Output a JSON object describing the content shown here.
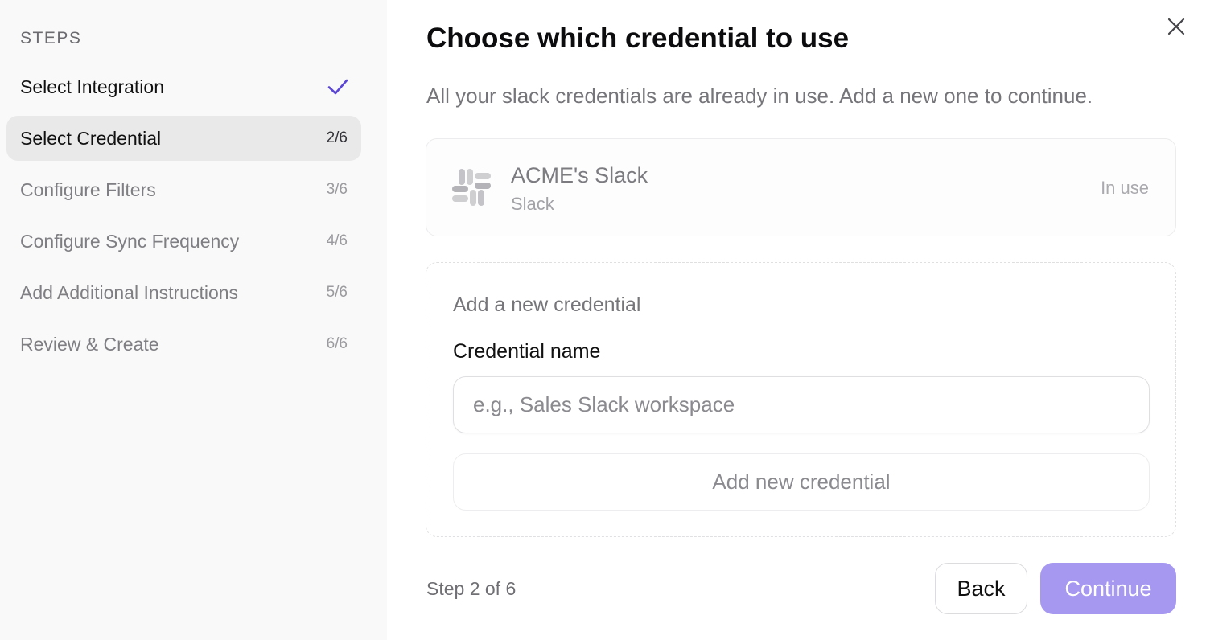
{
  "sidebar": {
    "heading": "STEPS",
    "steps": [
      {
        "label": "Select Integration",
        "count": "",
        "state": "done",
        "icon": "check-icon"
      },
      {
        "label": "Select Credential",
        "count": "2/6",
        "state": "active"
      },
      {
        "label": "Configure Filters",
        "count": "3/6",
        "state": "pending"
      },
      {
        "label": "Configure Sync Frequency",
        "count": "4/6",
        "state": "pending"
      },
      {
        "label": "Add Additional Instructions",
        "count": "5/6",
        "state": "pending"
      },
      {
        "label": "Review & Create",
        "count": "6/6",
        "state": "pending"
      }
    ]
  },
  "main": {
    "title": "Choose which credential to use",
    "subtitle": "All your slack credentials are already in use. Add a new one to continue.",
    "close_icon": "close-icon",
    "credential": {
      "name": "ACME's Slack",
      "type": "Slack",
      "status": "In use",
      "icon": "slack-icon"
    },
    "new_credential": {
      "heading": "Add a new credential",
      "field_label": "Credential name",
      "value": "",
      "placeholder": "e.g., Sales Slack workspace",
      "button_label": "Add new credential"
    },
    "footer": {
      "step_indicator": "Step 2 of 6",
      "back_label": "Back",
      "continue_label": "Continue"
    }
  },
  "colors": {
    "accent": "#5b45d6",
    "continue_button": "#a698f0",
    "sidebar_bg": "#f9f9f9",
    "active_step_bg": "#e9e9ea"
  }
}
